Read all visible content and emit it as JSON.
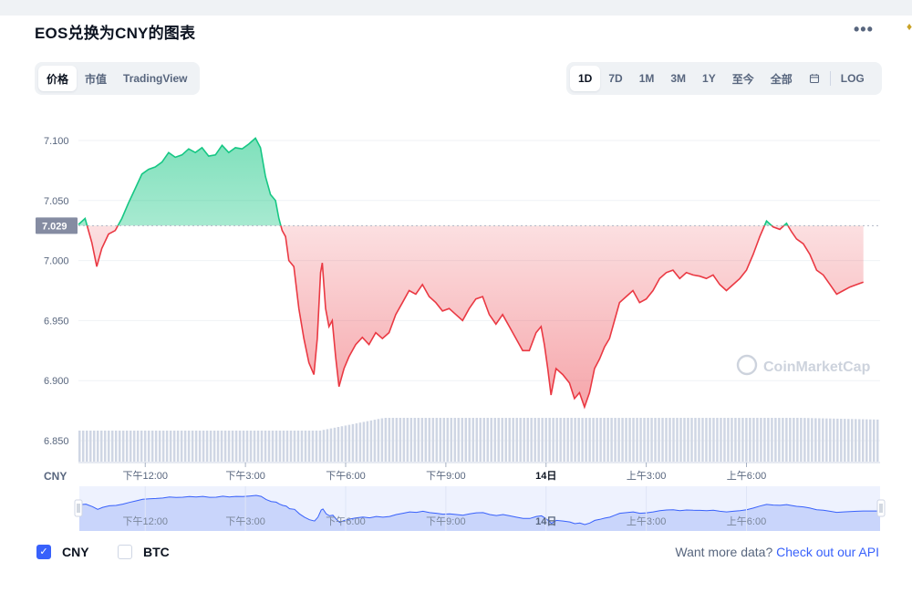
{
  "header": {
    "title": "EOS兑换为CNY的图表",
    "more_icon": "more-horizontal-icon"
  },
  "left_tabs": [
    {
      "label": "价格",
      "active": true
    },
    {
      "label": "市值",
      "active": false
    },
    {
      "label": "TradingView",
      "active": false
    }
  ],
  "range_tabs": [
    {
      "label": "1D",
      "active": true
    },
    {
      "label": "7D",
      "active": false
    },
    {
      "label": "1M",
      "active": false
    },
    {
      "label": "3M",
      "active": false
    },
    {
      "label": "1Y",
      "active": false
    },
    {
      "label": "至今",
      "active": false
    },
    {
      "label": "全部",
      "active": false
    }
  ],
  "calendar_icon": "calendar-icon",
  "log_label": "LOG",
  "legend": [
    {
      "label": "CNY",
      "checked": true
    },
    {
      "label": "BTC",
      "checked": false
    }
  ],
  "footer": {
    "text": "Want more data?",
    "link": "Check out our API"
  },
  "colors": {
    "up": "#16c784",
    "down": "#ea3943",
    "brush": "#3861fb",
    "volume": "#cfd6e4",
    "accent": "#3861fb"
  },
  "chart_data": {
    "type": "area",
    "ylabel": "CNY",
    "ylim": [
      6.85,
      7.105
    ],
    "yticks": [
      "7.100",
      "7.050",
      "7.000",
      "6.950",
      "6.900",
      "6.850"
    ],
    "reference_value": 7.029,
    "reference_label": "7.029",
    "x_start": 0,
    "x_end": 24,
    "xticks": [
      {
        "x": 2.0,
        "label": "下午12:00",
        "bold": false
      },
      {
        "x": 5.0,
        "label": "下午3:00",
        "bold": false
      },
      {
        "x": 8.0,
        "label": "下午6:00",
        "bold": false
      },
      {
        "x": 11.0,
        "label": "下午9:00",
        "bold": false
      },
      {
        "x": 14.0,
        "label": "14日",
        "bold": true
      },
      {
        "x": 17.0,
        "label": "上午3:00",
        "bold": false
      },
      {
        "x": 20.0,
        "label": "上午6:00",
        "bold": false
      }
    ],
    "watermark": "CoinMarketCap",
    "series": [
      {
        "values": [
          [
            0.0,
            7.03
          ],
          [
            0.2,
            7.035
          ],
          [
            0.4,
            7.015
          ],
          [
            0.55,
            6.995
          ],
          [
            0.7,
            7.01
          ],
          [
            0.9,
            7.022
          ],
          [
            1.1,
            7.025
          ],
          [
            1.3,
            7.035
          ],
          [
            1.5,
            7.048
          ],
          [
            1.7,
            7.06
          ],
          [
            1.9,
            7.072
          ],
          [
            2.1,
            7.076
          ],
          [
            2.3,
            7.078
          ],
          [
            2.5,
            7.082
          ],
          [
            2.7,
            7.09
          ],
          [
            2.9,
            7.086
          ],
          [
            3.1,
            7.088
          ],
          [
            3.3,
            7.093
          ],
          [
            3.5,
            7.09
          ],
          [
            3.7,
            7.094
          ],
          [
            3.9,
            7.087
          ],
          [
            4.1,
            7.088
          ],
          [
            4.3,
            7.096
          ],
          [
            4.5,
            7.09
          ],
          [
            4.7,
            7.094
          ],
          [
            4.9,
            7.093
          ],
          [
            5.1,
            7.097
          ],
          [
            5.3,
            7.102
          ],
          [
            5.45,
            7.094
          ],
          [
            5.6,
            7.07
          ],
          [
            5.75,
            7.055
          ],
          [
            5.9,
            7.05
          ],
          [
            6.0,
            7.035
          ],
          [
            6.1,
            7.025
          ],
          [
            6.2,
            7.02
          ],
          [
            6.3,
            7.0
          ],
          [
            6.45,
            6.995
          ],
          [
            6.6,
            6.96
          ],
          [
            6.75,
            6.935
          ],
          [
            6.9,
            6.915
          ],
          [
            7.05,
            6.905
          ],
          [
            7.15,
            6.935
          ],
          [
            7.25,
            6.99
          ],
          [
            7.3,
            6.998
          ],
          [
            7.4,
            6.96
          ],
          [
            7.5,
            6.945
          ],
          [
            7.6,
            6.95
          ],
          [
            7.7,
            6.92
          ],
          [
            7.8,
            6.895
          ],
          [
            7.95,
            6.91
          ],
          [
            8.1,
            6.92
          ],
          [
            8.3,
            6.93
          ],
          [
            8.5,
            6.936
          ],
          [
            8.7,
            6.93
          ],
          [
            8.9,
            6.94
          ],
          [
            9.1,
            6.935
          ],
          [
            9.3,
            6.94
          ],
          [
            9.5,
            6.955
          ],
          [
            9.7,
            6.965
          ],
          [
            9.9,
            6.975
          ],
          [
            10.1,
            6.972
          ],
          [
            10.3,
            6.98
          ],
          [
            10.5,
            6.97
          ],
          [
            10.7,
            6.965
          ],
          [
            10.9,
            6.958
          ],
          [
            11.1,
            6.96
          ],
          [
            11.3,
            6.955
          ],
          [
            11.5,
            6.95
          ],
          [
            11.7,
            6.96
          ],
          [
            11.9,
            6.968
          ],
          [
            12.1,
            6.97
          ],
          [
            12.3,
            6.955
          ],
          [
            12.5,
            6.947
          ],
          [
            12.7,
            6.955
          ],
          [
            12.9,
            6.945
          ],
          [
            13.1,
            6.935
          ],
          [
            13.3,
            6.925
          ],
          [
            13.5,
            6.925
          ],
          [
            13.7,
            6.94
          ],
          [
            13.85,
            6.945
          ],
          [
            13.95,
            6.93
          ],
          [
            14.05,
            6.91
          ],
          [
            14.15,
            6.888
          ],
          [
            14.3,
            6.91
          ],
          [
            14.5,
            6.905
          ],
          [
            14.7,
            6.898
          ],
          [
            14.85,
            6.885
          ],
          [
            15.0,
            6.89
          ],
          [
            15.15,
            6.878
          ],
          [
            15.3,
            6.89
          ],
          [
            15.45,
            6.91
          ],
          [
            15.6,
            6.918
          ],
          [
            15.75,
            6.928
          ],
          [
            15.9,
            6.935
          ],
          [
            16.05,
            6.95
          ],
          [
            16.2,
            6.965
          ],
          [
            16.4,
            6.97
          ],
          [
            16.6,
            6.975
          ],
          [
            16.8,
            6.965
          ],
          [
            17.0,
            6.968
          ],
          [
            17.2,
            6.975
          ],
          [
            17.4,
            6.985
          ],
          [
            17.6,
            6.99
          ],
          [
            17.8,
            6.992
          ],
          [
            18.0,
            6.985
          ],
          [
            18.2,
            6.99
          ],
          [
            18.4,
            6.988
          ],
          [
            18.6,
            6.987
          ],
          [
            18.8,
            6.985
          ],
          [
            19.0,
            6.988
          ],
          [
            19.2,
            6.98
          ],
          [
            19.4,
            6.975
          ],
          [
            19.6,
            6.98
          ],
          [
            19.8,
            6.985
          ],
          [
            20.0,
            6.992
          ],
          [
            20.2,
            7.005
          ],
          [
            20.4,
            7.02
          ],
          [
            20.6,
            7.033
          ],
          [
            20.8,
            7.028
          ],
          [
            21.0,
            7.026
          ],
          [
            21.2,
            7.031
          ],
          [
            21.35,
            7.024
          ],
          [
            21.5,
            7.018
          ],
          [
            21.7,
            7.014
          ],
          [
            21.9,
            7.005
          ],
          [
            22.1,
            6.992
          ],
          [
            22.3,
            6.988
          ],
          [
            22.5,
            6.98
          ],
          [
            22.7,
            6.972
          ],
          [
            22.9,
            6.975
          ],
          [
            23.1,
            6.978
          ],
          [
            23.3,
            6.98
          ],
          [
            23.5,
            6.982
          ]
        ]
      }
    ]
  }
}
